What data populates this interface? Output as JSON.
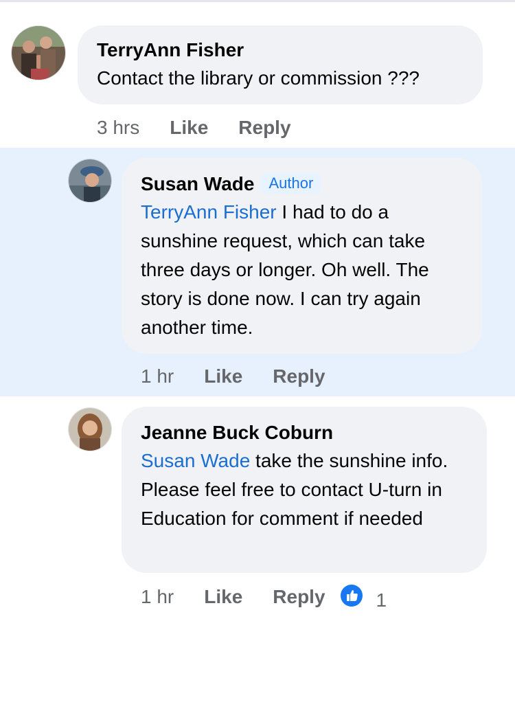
{
  "comments": [
    {
      "author": "TerryAnn Fisher",
      "text": "Contact the library or commission ???",
      "time": "3 hrs",
      "like_label": "Like",
      "reply_label": "Reply"
    },
    {
      "author": "Susan Wade",
      "badge": "Author",
      "mention": "TerryAnn Fisher",
      "text": " I had to do a sunshine request, which can take three days or longer. Oh well. The story is done now. I can try again another time.",
      "time": "1 hr",
      "like_label": "Like",
      "reply_label": "Reply"
    },
    {
      "author": "Jeanne Buck Coburn",
      "mention": "Susan Wade",
      "text": " take the sunshine info. Please feel free to contact U-turn in Education for comment if needed",
      "time": "1 hr",
      "like_label": "Like",
      "reply_label": "Reply",
      "reaction_icon": "like-thumbs-up-icon",
      "reaction_count": "1"
    }
  ],
  "colors": {
    "highlight_bg": "#e7f0fd",
    "bubble_bg": "#f0f2f5",
    "mention": "#1b6ed1",
    "meta_text": "#65676b",
    "reaction_blue": "#1877f2"
  }
}
